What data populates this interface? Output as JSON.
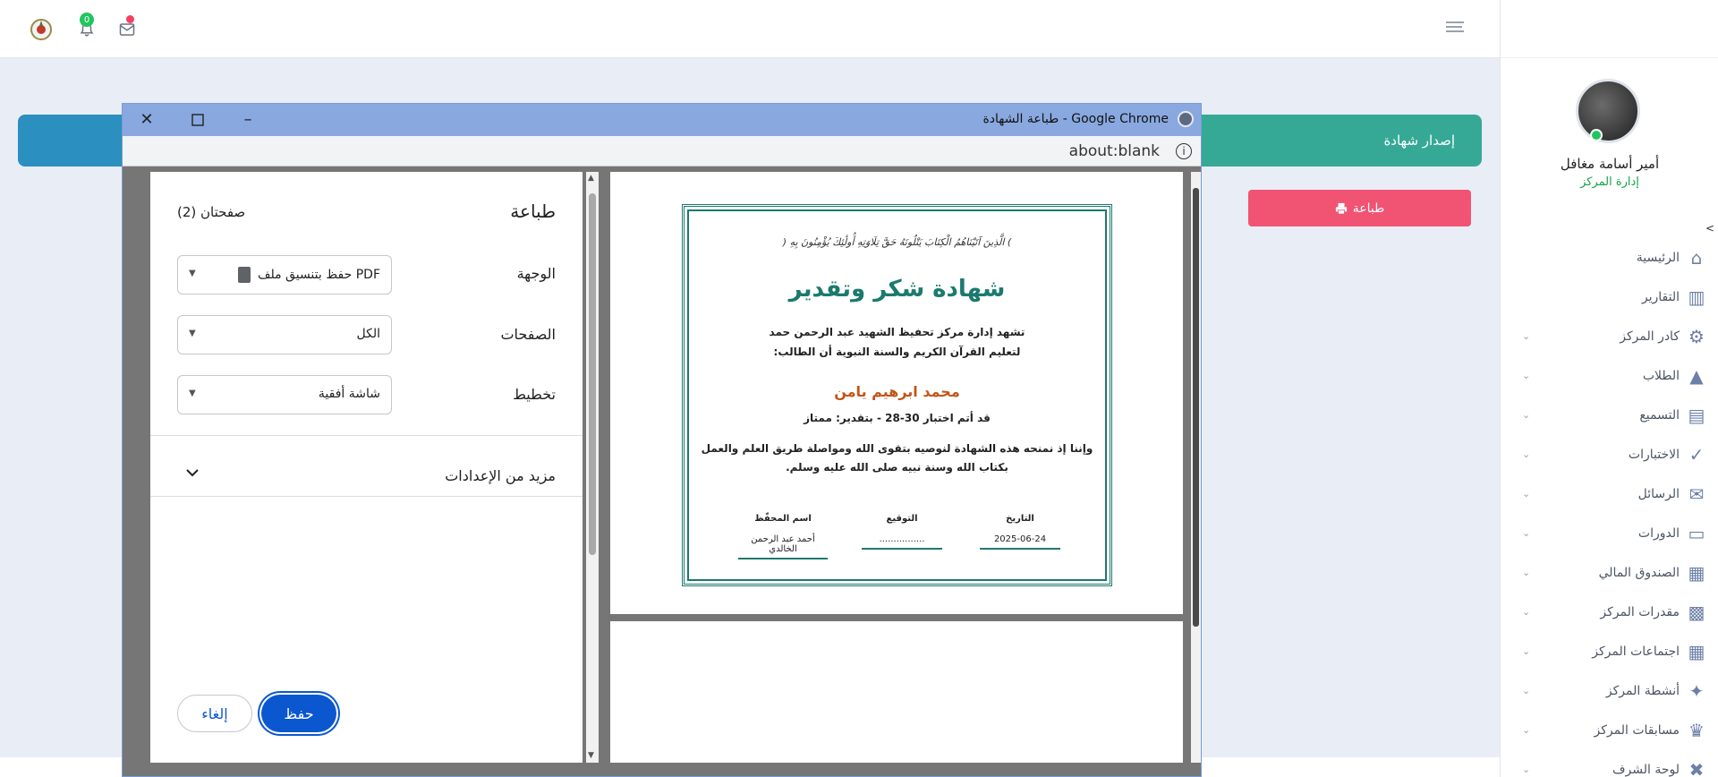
{
  "header": {
    "notification_count": "0"
  },
  "sidebar": {
    "user_name": "أمير أسامة مغافل",
    "user_role": "إدارة المركز",
    "items": [
      {
        "label": "الرئيسية",
        "icon": "home-icon",
        "caret": false
      },
      {
        "label": "التقارير",
        "icon": "chart-icon",
        "caret": false
      },
      {
        "label": "كادر المركز",
        "icon": "users-gear-icon",
        "caret": true
      },
      {
        "label": "الطلاب",
        "icon": "graduation-cap-icon",
        "caret": true
      },
      {
        "label": "التسميع",
        "icon": "book-icon",
        "caret": true
      },
      {
        "label": "الاختبارات",
        "icon": "clipboard-check-icon",
        "caret": true
      },
      {
        "label": "الرسائل",
        "icon": "envelope-icon",
        "caret": true
      },
      {
        "label": "الدورات",
        "icon": "chalkboard-icon",
        "caret": true
      },
      {
        "label": "الصندوق المالي",
        "icon": "cash-register-icon",
        "caret": true
      },
      {
        "label": "مقدرات المركز",
        "icon": "boxes-icon",
        "caret": true
      },
      {
        "label": "اجتماعات المركز",
        "icon": "calendar-icon",
        "caret": true
      },
      {
        "label": "أنشطة المركز",
        "icon": "running-icon",
        "caret": true
      },
      {
        "label": "مسابقات المركز",
        "icon": "trophy-icon",
        "caret": true
      },
      {
        "label": "لوحة الشرف",
        "icon": "medal-icon",
        "caret": true
      }
    ]
  },
  "page": {
    "banner_title": "إصدار شهادة",
    "print_button": "طباعة"
  },
  "chrome": {
    "window_title": "طباعة الشهادة - Google Chrome",
    "url": "about:blank"
  },
  "print_dialog": {
    "title": "طباعة",
    "page_count": "صفحتان (2)",
    "destination_label": "الوجهة",
    "destination_value": "حفظ بتنسيق ملف PDF",
    "pages_label": "الصفحات",
    "pages_value": "الكل",
    "layout_label": "تخطيط",
    "layout_value": "شاشة أفقية",
    "more_settings": "مزيد من الإعدادات",
    "save_button": "حفظ",
    "cancel_button": "إلغاء"
  },
  "certificate": {
    "verse": ") الَّذِينَ آتَيْنَاهُمُ الْكِتَابَ يَتْلُونَهُ حَقَّ تِلَاوَتِهِ أُولَٰئِكَ يُؤْمِنُونَ بِهِ (",
    "title": "شهادة شكر وتقدير",
    "line1": "تشهد إدارة مركز تحفيظ الشهيد عبد الرحمن حمد",
    "line2": ":لتعليم القرآن الكريم والسنة النبوية أن الطالب",
    "student_name": "محمد ابرهيم يامن",
    "exam_line": "قد أتم اختبار 30-28 - بتقدير: ممتاز",
    "wish_line1": "وإننا إذ نمنحه هذه الشهادة لنوصيه بتقوى الله ومواصلة طريق العلم والعمل",
    "wish_line2": ".بكتاب الله وسنة نبيه صلى الله عليه وسلم",
    "date_label": "التاريخ",
    "date_value": "2025-06-24",
    "signature_label": "التوقيع",
    "signature_value": "................",
    "teacher_label": "اسم المحفّظ",
    "teacher_value": "أحمد عبد الرحمن الخالدي"
  },
  "colors": {
    "accent_teal": "#35a996",
    "print_pink": "#f15373",
    "chrome_blue": "#89a8e0",
    "save_blue": "#0b57d0",
    "cert_green": "#1b7a6e",
    "student_orange": "#c2561a"
  }
}
